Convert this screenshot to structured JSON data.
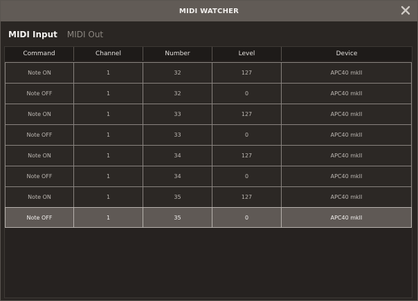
{
  "window": {
    "title": "MIDI WATCHER"
  },
  "tabs": [
    {
      "label": "MIDI Input",
      "active": true
    },
    {
      "label": "MIDI Out",
      "active": false
    }
  ],
  "table": {
    "columns": [
      "Command",
      "Channel",
      "Number",
      "Level",
      "Device"
    ],
    "rows": [
      [
        "Note ON",
        "1",
        "32",
        "127",
        "APC40 mkII"
      ],
      [
        "Note OFF",
        "1",
        "32",
        "0",
        "APC40 mkII"
      ],
      [
        "Note ON",
        "1",
        "33",
        "127",
        "APC40 mkII"
      ],
      [
        "Note OFF",
        "1",
        "33",
        "0",
        "APC40 mkII"
      ],
      [
        "Note ON",
        "1",
        "34",
        "127",
        "APC40 mkII"
      ],
      [
        "Note OFF",
        "1",
        "34",
        "0",
        "APC40 mkII"
      ],
      [
        "Note ON",
        "1",
        "35",
        "127",
        "APC40 mkII"
      ],
      [
        "Note OFF",
        "1",
        "35",
        "0",
        "APC40 mkII"
      ]
    ]
  },
  "colors": {
    "titlebar": "#615b56",
    "background": "#2a2623",
    "selected_row": "#5f5955"
  },
  "icons": {
    "close": "close-icon"
  }
}
